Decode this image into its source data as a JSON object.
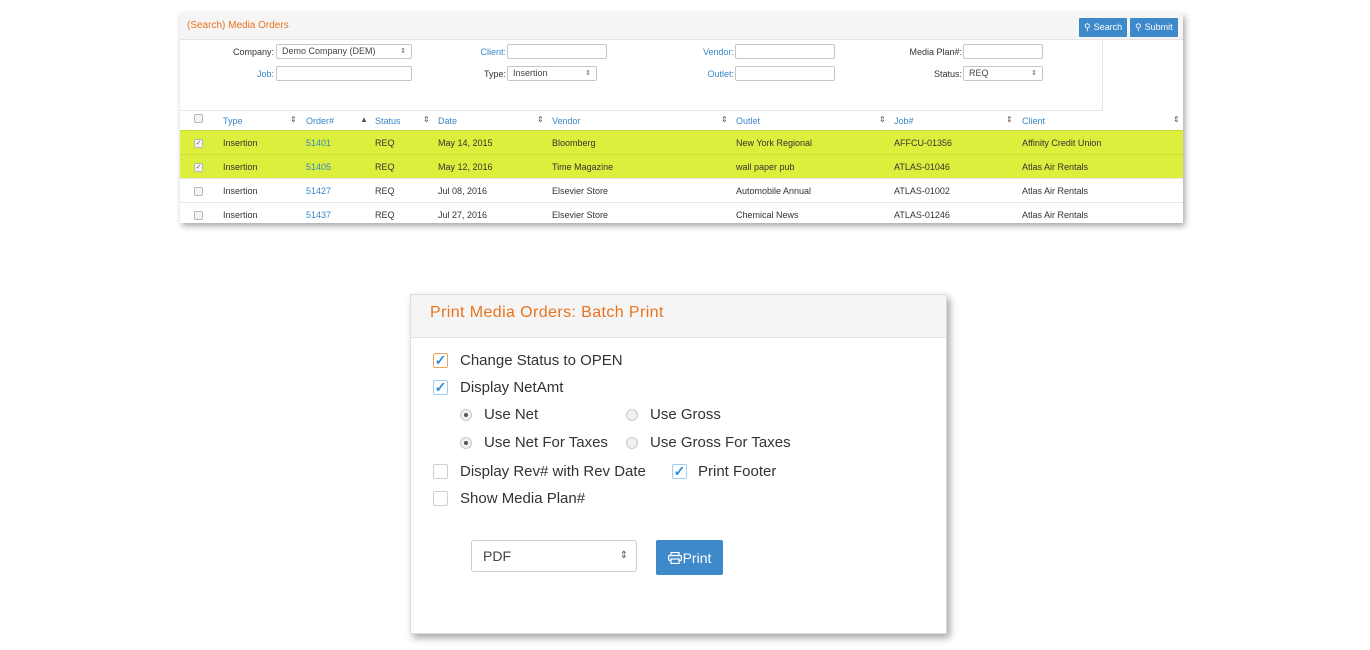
{
  "search": {
    "title": "(Search) Media Orders",
    "search_label": "Search",
    "submit_label": "Submit",
    "filters": {
      "company_label": "Company:",
      "company_value": "Demo Company (DEM)",
      "client_label": "Client:",
      "vendor_label": "Vendor:",
      "mediaplan_label": "Media Plan#:",
      "job_label": "Job:",
      "type_label": "Type:",
      "type_value": "Insertion",
      "outlet_label": "Outlet:",
      "status_label": "Status:",
      "status_value": "REQ"
    },
    "columns": [
      "Type",
      "Order#",
      "Status",
      "Date",
      "Vendor",
      "Outlet",
      "Job#",
      "Client"
    ],
    "rows": [
      {
        "selected": true,
        "type": "Insertion",
        "order": "51401",
        "status": "REQ",
        "date": "May 14, 2015",
        "vendor": "Bloomberg",
        "outlet": "New York Regional",
        "job": "AFFCU-01356",
        "client": "Affinity Credit Union"
      },
      {
        "selected": true,
        "type": "Insertion",
        "order": "51405",
        "status": "REQ",
        "date": "May 12, 2016",
        "vendor": "Time Magazine",
        "outlet": "wall paper pub",
        "job": "ATLAS-01046",
        "client": "Atlas Air Rentals"
      },
      {
        "selected": false,
        "type": "Insertion",
        "order": "51427",
        "status": "REQ",
        "date": "Jul 08, 2016",
        "vendor": "Elsevier Store",
        "outlet": "Automobile Annual",
        "job": "ATLAS-01002",
        "client": "Atlas Air Rentals"
      },
      {
        "selected": false,
        "type": "Insertion",
        "order": "51437",
        "status": "REQ",
        "date": "Jul 27, 2016",
        "vendor": "Elsevier Store",
        "outlet": "Chemical News",
        "job": "ATLAS-01246",
        "client": "Atlas Air Rentals"
      }
    ],
    "colors": {
      "accent": "#e8731e",
      "link": "#3a86c8",
      "selected_row": "#dcef3c",
      "button": "#3e89c9"
    }
  },
  "print": {
    "title": "Print Media Orders: Batch Print",
    "change_status": {
      "label": "Change Status to OPEN",
      "checked": true
    },
    "display_netamt": {
      "label": "Display NetAmt",
      "checked": true
    },
    "use_net": {
      "label": "Use Net",
      "selected": true
    },
    "use_gross": {
      "label": "Use Gross",
      "selected": false
    },
    "use_net_taxes": {
      "label": "Use Net For Taxes",
      "selected": true
    },
    "use_gross_taxes": {
      "label": "Use Gross For Taxes",
      "selected": false
    },
    "display_rev": {
      "label": "Display Rev# with Rev Date",
      "checked": false
    },
    "print_footer": {
      "label": "Print Footer",
      "checked": true
    },
    "show_media_plan": {
      "label": "Show Media Plan#",
      "checked": false
    },
    "format_value": "PDF",
    "print_label": "Print"
  }
}
